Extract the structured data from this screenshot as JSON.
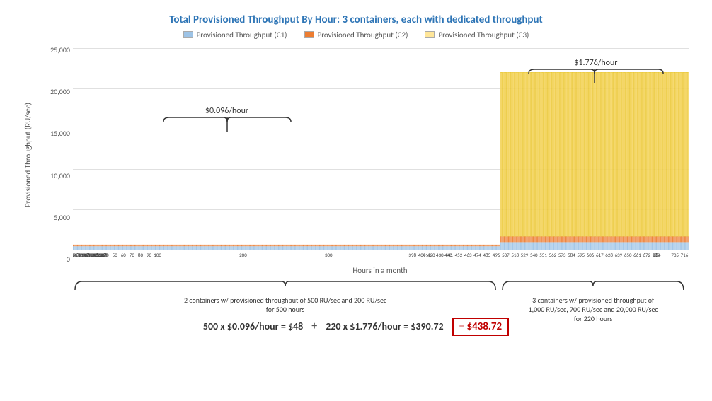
{
  "title": {
    "prefix": "Total Provisioned Throughput By Hour: ",
    "highlight": "3 containers, each with dedicated throughput"
  },
  "legend": {
    "items": [
      {
        "label": "Provisioned Throughput (C1)",
        "color": "#9DC3E6"
      },
      {
        "label": "Provisioned Throughput (C2)",
        "color": "#ED7D31"
      },
      {
        "label": "Provisioned Throughput (C3)",
        "color": "#FFE699"
      }
    ]
  },
  "yAxis": {
    "label": "Provisioned Throughput (RU/sec)",
    "ticks": [
      "0",
      "5,000",
      "10,000",
      "15,000",
      "20,000",
      "25,000"
    ]
  },
  "xAxis": {
    "label": "Hours in a month",
    "ticks_phase1": [
      "1",
      "2",
      "3",
      "4",
      "5",
      "6",
      "7",
      "8",
      "9",
      "10",
      "11",
      "12",
      "13",
      "14",
      "15",
      "16",
      "17",
      "18",
      "19",
      "21",
      "22",
      "23",
      "24",
      "25",
      "26",
      "27",
      "28",
      "29",
      "30",
      "31",
      "32",
      "33",
      "34",
      "35",
      "36",
      "37",
      "38",
      "39",
      "40",
      "50",
      "60",
      "70",
      "80",
      "90",
      "100",
      "200",
      "300",
      "398",
      "409",
      "415",
      "420",
      "430",
      "440",
      "441",
      "452",
      "463",
      "474",
      "485",
      "496"
    ],
    "ticks_phase2": [
      "507",
      "518",
      "529",
      "540",
      "551",
      "562",
      "573",
      "584",
      "595",
      "606",
      "617",
      "628",
      "639",
      "650",
      "661",
      "672",
      "683",
      "684",
      "705",
      "716"
    ]
  },
  "annotations": {
    "phase1": {
      "price": "$0.096/hour",
      "desc_line1": "2 containers w/ provisioned throughput of 500 RU/sec and 200 RU/sec",
      "desc_line2": "for 500 hours",
      "hours": "500"
    },
    "phase2": {
      "price": "$1.776/hour",
      "desc_line1": "3 containers w/ provisioned throughput of",
      "desc_line2": "1,000 RU/sec, 700 RU/sec and 20,000 RU/sec",
      "desc_line3": "for 220 hours",
      "hours": "220"
    }
  },
  "footer": {
    "eq1": "500 x $0.096/hour = $48",
    "plus": "+",
    "eq2": "220 x $1.776/hour = $390.72",
    "result": "= $438.72"
  }
}
